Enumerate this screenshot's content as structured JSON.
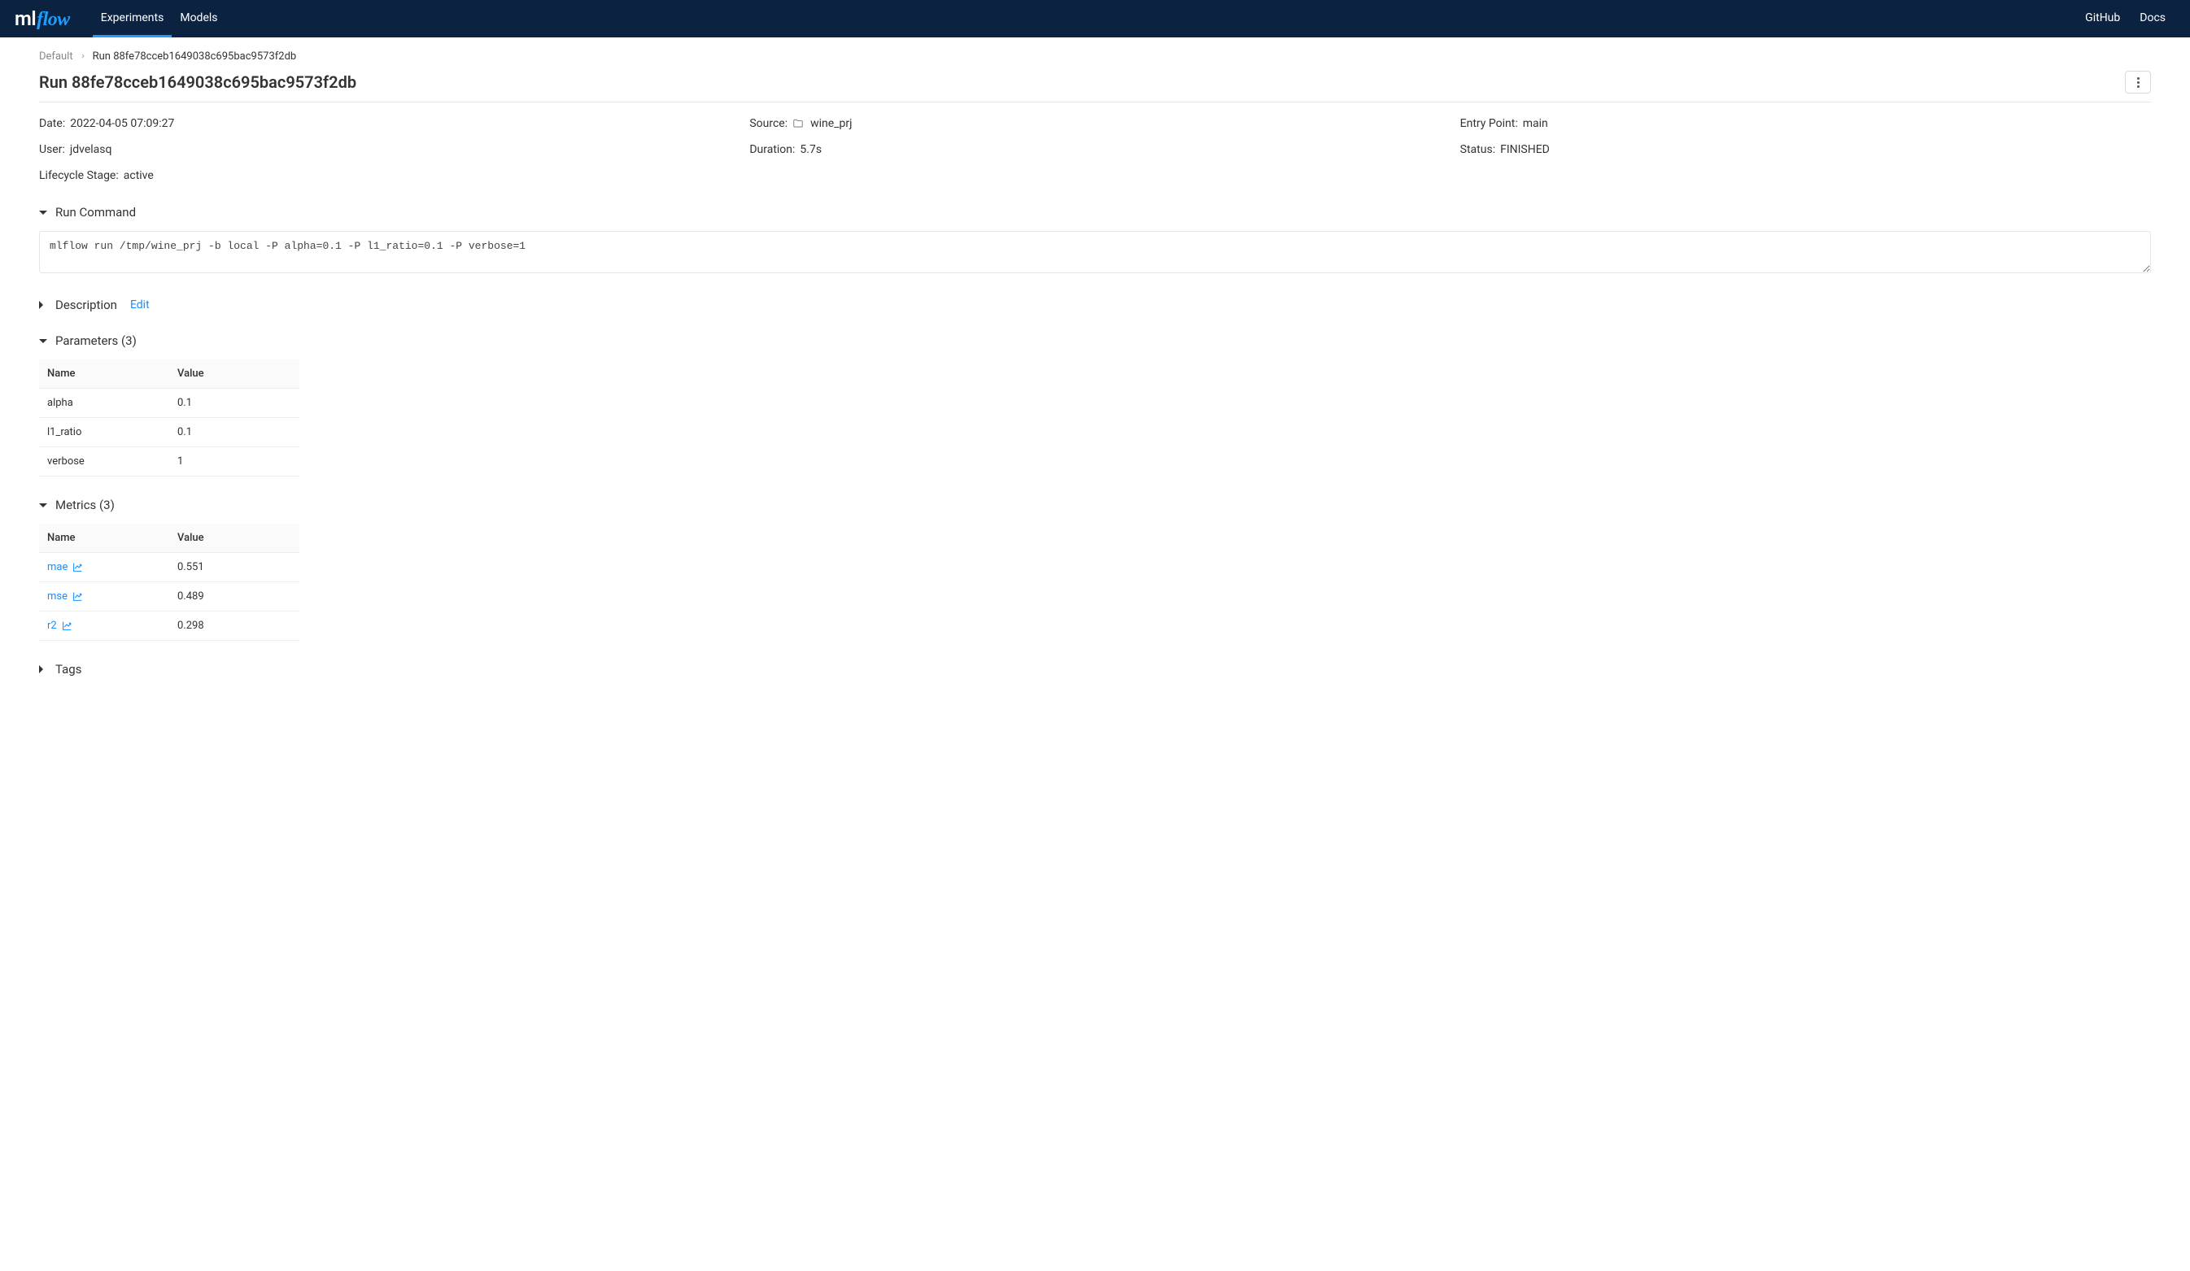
{
  "nav": {
    "logo_ml": "ml",
    "logo_flow": "flow",
    "experiments": "Experiments",
    "models": "Models",
    "github": "GitHub",
    "docs": "Docs"
  },
  "breadcrumb": {
    "root": "Default",
    "current": "Run 88fe78cceb1649038c695bac9573f2db"
  },
  "page_title": "Run 88fe78cceb1649038c695bac9573f2db",
  "meta": {
    "date_label": "Date",
    "date_value": "2022-04-05 07:09:27",
    "source_label": "Source",
    "source_value": "wine_prj",
    "entry_label": "Entry Point",
    "entry_value": "main",
    "user_label": "User",
    "user_value": "jdvelasq",
    "duration_label": "Duration",
    "duration_value": "5.7s",
    "status_label": "Status",
    "status_value": "FINISHED",
    "lifecycle_label": "Lifecycle Stage",
    "lifecycle_value": "active"
  },
  "sections": {
    "run_command": "Run Command",
    "description": "Description",
    "description_edit": "Edit",
    "parameters": "Parameters (3)",
    "metrics": "Metrics (3)",
    "tags": "Tags"
  },
  "run_command_value": "mlflow run /tmp/wine_prj -b local -P alpha=0.1 -P l1_ratio=0.1 -P verbose=1",
  "table_headers": {
    "name": "Name",
    "value": "Value"
  },
  "parameters": [
    {
      "name": "alpha",
      "value": "0.1"
    },
    {
      "name": "l1_ratio",
      "value": "0.1"
    },
    {
      "name": "verbose",
      "value": "1"
    }
  ],
  "metrics": [
    {
      "name": "mae",
      "value": "0.551"
    },
    {
      "name": "mse",
      "value": "0.489"
    },
    {
      "name": "r2",
      "value": "0.298"
    }
  ]
}
